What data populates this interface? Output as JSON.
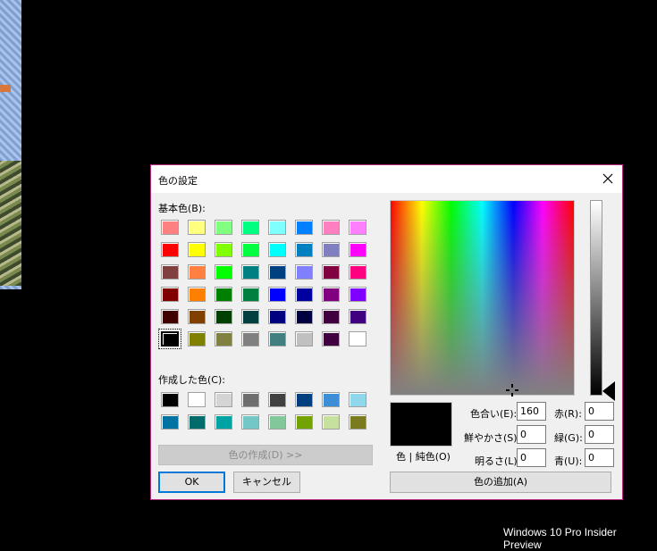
{
  "taskbar": {
    "edition_text": "Windows 10 Pro Insider Preview"
  },
  "dialog": {
    "title": "色の設定",
    "basic_colors_label": "基本色(B):",
    "basic_colors": [
      [
        "#ff8080",
        "#ffff80",
        "#80ff80",
        "#00ff80",
        "#80ffff",
        "#0080ff",
        "#ff80c0",
        "#ff80ff"
      ],
      [
        "#ff0000",
        "#ffff00",
        "#80ff00",
        "#00ff40",
        "#00ffff",
        "#0080c0",
        "#8080c0",
        "#ff00ff"
      ],
      [
        "#804040",
        "#ff8040",
        "#00ff00",
        "#008080",
        "#004080",
        "#8080ff",
        "#800040",
        "#ff0080"
      ],
      [
        "#800000",
        "#ff8000",
        "#008000",
        "#008040",
        "#0000ff",
        "#0000a0",
        "#800080",
        "#8000ff"
      ],
      [
        "#400000",
        "#804000",
        "#004000",
        "#004040",
        "#000080",
        "#000040",
        "#400040",
        "#400080"
      ],
      [
        "#000000",
        "#808000",
        "#808040",
        "#808080",
        "#408080",
        "#c0c0c0",
        "#400040",
        "#ffffff"
      ]
    ],
    "custom_colors_label": "作成した色(C):",
    "custom_colors": [
      [
        "#000000",
        "#ffffff",
        "#d4d4d4",
        "#6e6e6e",
        "#404040",
        "#003f7f",
        "#3c8fd6",
        "#8fd7eb"
      ],
      [
        "#0073a3",
        "#006b6b",
        "#00a3a3",
        "#73c7c7",
        "#80c799",
        "#73a300",
        "#c7e09e",
        "#7a7a1f"
      ]
    ],
    "define_custom_button": "色の作成(D) >>",
    "ok_button": "OK",
    "cancel_button": "キャンセル",
    "color_solid_label": "色 | 純色(O)",
    "hue_label": "色合い(E):",
    "hue_value": "160",
    "sat_label": "鮮やかさ(S):",
    "sat_value": "0",
    "lum_label": "明るさ(L):",
    "lum_value": "0",
    "red_label": "赤(R):",
    "red_value": "0",
    "green_label": "緑(G):",
    "green_value": "0",
    "blue_label": "青(U):",
    "blue_value": "0",
    "add_custom_button": "色の追加(A)",
    "selected_color": "#000000"
  }
}
